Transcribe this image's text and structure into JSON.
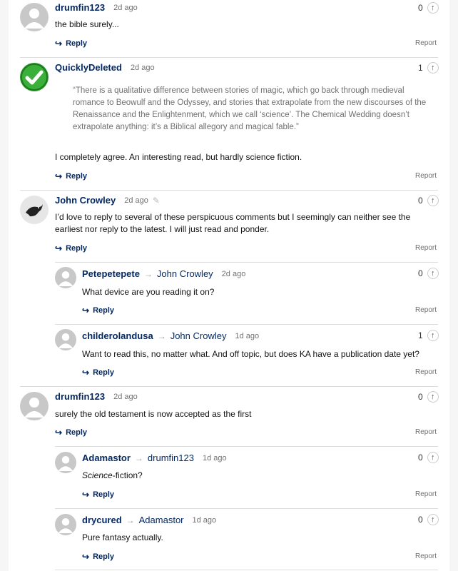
{
  "icons": {
    "reply": "reply-arrow-icon",
    "upvote": "up-arrow-icon",
    "avatar": "default-avatar-icon",
    "pick": "pencil-icon"
  },
  "colors": {
    "link": "#052962",
    "check": "#2e9d2e",
    "muted": "#707070"
  },
  "reply_label": "Reply",
  "report_label": "Report",
  "reply_arrow_glyph": "↪",
  "upvote_glyph": "↑",
  "c1": {
    "author": "drumfin123",
    "time": "2d ago",
    "votes": "0",
    "body": "the bible surely..."
  },
  "c2": {
    "author": "QuicklyDeleted",
    "time": "2d ago",
    "votes": "1",
    "quote": "“There is a qualitative difference between stories of magic, which go back through medieval romance to Beowulf and the Odyssey, and stories that extrapolate from the new discourses of the Renaissance and the Enlightenment, which we call ‘science’. The Chemical Wedding doesn’t extrapolate anything: it’s a Biblical allegory and magical fable.”",
    "body": "I completely agree. An interesting read, but hardly science fiction."
  },
  "c3": {
    "author": "John Crowley",
    "time": "2d ago",
    "votes": "0",
    "body": "I’d love to reply to several of these perspicuous comments but I seemingly can neither see the earliest nor reply to the latest. I will just read and ponder."
  },
  "c4": {
    "author": "Petepetepete",
    "recipient": "John Crowley",
    "time": "2d ago",
    "votes": "0",
    "body": "What device are you reading it on?"
  },
  "c5": {
    "author": "childerolandusa",
    "recipient": "John Crowley",
    "time": "1d ago",
    "votes": "1",
    "body": "Want to read this, no matter what. And off topic, but does KA have a publication date yet?"
  },
  "c6": {
    "author": "drumfin123",
    "time": "2d ago",
    "votes": "0",
    "body": "surely the old testament is now accepted as the first"
  },
  "c7": {
    "author": "Adamastor",
    "recipient": "drumfin123",
    "time": "1d ago",
    "votes": "0",
    "body_em": "Science",
    "body_rest": "-fiction?"
  },
  "c8": {
    "author": "drycured",
    "recipient": "Adamastor",
    "time": "1d ago",
    "votes": "0",
    "body": "Pure fantasy actually."
  }
}
